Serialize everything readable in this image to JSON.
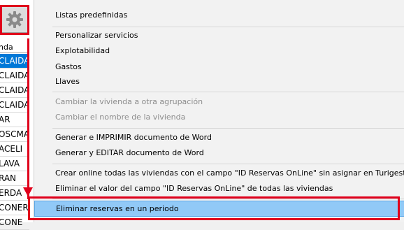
{
  "list": {
    "header": "nda",
    "rows": [
      {
        "text": "CLAIDA",
        "selected": true
      },
      {
        "text": "CLAIDA",
        "selected": false
      },
      {
        "text": "CLAIDA",
        "selected": false
      },
      {
        "text": "CLAIDA",
        "selected": false
      },
      {
        "text": "AR",
        "selected": false
      },
      {
        "text": "OSCMA",
        "selected": false
      },
      {
        "text": "ACELI",
        "selected": false
      },
      {
        "text": "LAVA",
        "selected": false
      },
      {
        "text": "RAN",
        "selected": false
      },
      {
        "text": "ERDA",
        "selected": false
      },
      {
        "text": "CONER",
        "selected": false
      },
      {
        "text": "CONE",
        "selected": false
      }
    ]
  },
  "menu": {
    "items": {
      "listas": "Listas predefinidas",
      "personalizar": "Personalizar servicios",
      "explotabilidad": "Explotabilidad",
      "gastos": "Gastos",
      "llaves": "Llaves",
      "cambiar_agrupacion": "Cambiar la vivienda a otra agrupación",
      "cambiar_nombre": "Cambiar el nombre de la vivienda",
      "generar_imprimir": "Generar e IMPRIMIR documento de Word",
      "generar_editar": "Generar y EDITAR documento de Word",
      "crear_online": "Crear online todas las viviendas con el campo \"ID Reservas OnLine\" sin asignar en Turigest",
      "eliminar_valor": "Eliminar el valor del campo \"ID Reservas OnLine\" de todas las viviendas",
      "eliminar_reservas": "Eliminar reservas en un periodo"
    }
  },
  "colors": {
    "highlight_red": "#e0001b",
    "menu_hover": "#91c9f7",
    "selection_blue": "#0078d7"
  },
  "icons": {
    "settings": "gear-icon"
  }
}
